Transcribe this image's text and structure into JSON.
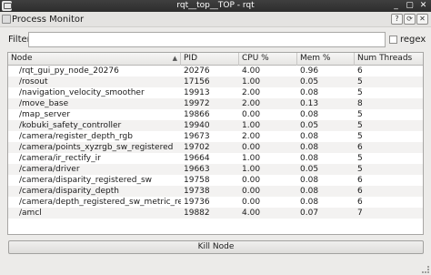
{
  "window": {
    "title": "rqt__top__TOP - rqt",
    "menu_icon": "app-window-icon",
    "buttons": {
      "minimize": "_",
      "maximize": "▢",
      "close": "✕"
    }
  },
  "plugin": {
    "title": "Process Monitor",
    "buttons": {
      "help": "?",
      "reload": "⟳",
      "close": "✕"
    }
  },
  "filter": {
    "label": "Filter",
    "value": "",
    "placeholder": "",
    "regex_label": "regex",
    "regex_checked": false
  },
  "table": {
    "columns": [
      "Node",
      "PID",
      "CPU %",
      "Mem %",
      "Num Threads"
    ],
    "sort_indicator": "▲",
    "rows": [
      [
        "/rqt_gui_py_node_20276",
        "20276",
        "4.00",
        "0.96",
        "6"
      ],
      [
        "/rosout",
        "17156",
        "1.00",
        "0.05",
        "5"
      ],
      [
        "/navigation_velocity_smoother",
        "19913",
        "2.00",
        "0.08",
        "5"
      ],
      [
        "/move_base",
        "19972",
        "2.00",
        "0.13",
        "8"
      ],
      [
        "/map_server",
        "19866",
        "0.00",
        "0.08",
        "5"
      ],
      [
        "/kobuki_safety_controller",
        "19940",
        "1.00",
        "0.05",
        "5"
      ],
      [
        "/camera/register_depth_rgb",
        "19673",
        "2.00",
        "0.08",
        "5"
      ],
      [
        "/camera/points_xyzrgb_sw_registered",
        "19702",
        "0.00",
        "0.08",
        "6"
      ],
      [
        "/camera/ir_rectify_ir",
        "19664",
        "1.00",
        "0.08",
        "5"
      ],
      [
        "/camera/driver",
        "19663",
        "1.00",
        "0.05",
        "5"
      ],
      [
        "/camera/disparity_registered_sw",
        "19758",
        "0.00",
        "0.08",
        "6"
      ],
      [
        "/camera/disparity_depth",
        "19738",
        "0.00",
        "0.08",
        "6"
      ],
      [
        "/camera/depth_registered_sw_metric_rect",
        "19736",
        "0.00",
        "0.08",
        "6"
      ],
      [
        "/amcl",
        "19882",
        "4.00",
        "0.07",
        "7"
      ]
    ]
  },
  "actions": {
    "kill_label": "Kill Node"
  }
}
